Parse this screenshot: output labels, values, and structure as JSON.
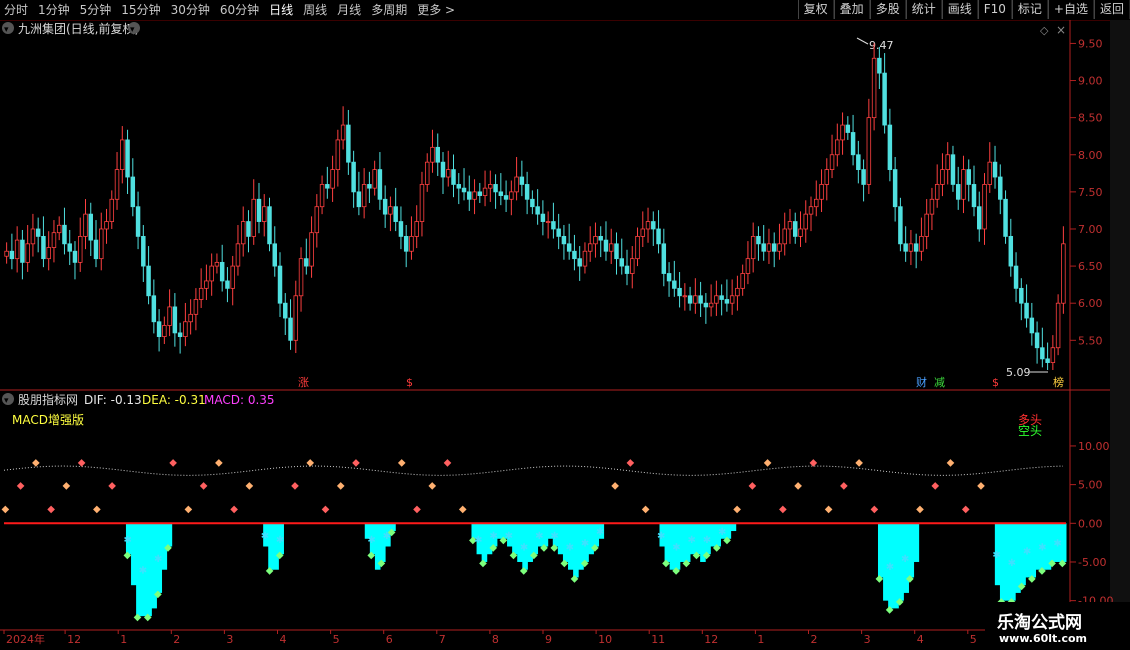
{
  "toolbar": {
    "periods": [
      "分时",
      "1分钟",
      "5分钟",
      "15分钟",
      "30分钟",
      "60分钟",
      "日线",
      "周线",
      "月线",
      "多周期",
      "更多 >"
    ],
    "active_period": "日线",
    "buttons": [
      "复权",
      "叠加",
      "多股",
      "统计",
      "画线",
      "F10",
      "标记",
      "+自选",
      "返回"
    ]
  },
  "stock": {
    "title": "九洲集团(日线,前复权)",
    "high_label": "9.47",
    "low_label": "5.09"
  },
  "indicator": {
    "source": "股朋指标网",
    "dif_text": "DIF: -0.13",
    "dea_text": "DEA: -0.31",
    "macd_text": "MACD: 0.35",
    "name": "MACD增强版",
    "legend_bull": "多头",
    "legend_bear": "空头"
  },
  "markers": [
    {
      "text": "涨",
      "color": "#ff3b3b"
    },
    {
      "text": "$",
      "color": "#ff3b3b"
    },
    {
      "text": "财",
      "color": "#4aa0ff"
    },
    {
      "text": "减",
      "color": "#3cdc3c"
    },
    {
      "text": "$",
      "color": "#ff3b3b"
    },
    {
      "text": "榜",
      "color": "#ffd040"
    }
  ],
  "watermark": {
    "line1": "乐淘公式网",
    "line2": "www.60lt.com"
  },
  "colors": {
    "up": "#ff4040",
    "down": "#50e0e0",
    "axis": "#b02020",
    "cyan_bar": "#00ffff",
    "red_line": "#ff1a1a"
  },
  "chart_data": [
    {
      "type": "candlestick",
      "title": "九洲集团(日线,前复权)",
      "ylim": [
        5.1,
        9.6
      ],
      "yticks": [
        5.5,
        6.0,
        6.5,
        7.0,
        7.5,
        8.0,
        8.5,
        9.0,
        9.5
      ],
      "x_tick_labels": [
        "2024年",
        "12",
        "1",
        "2",
        "3",
        "4",
        "5",
        "6",
        "7",
        "8",
        "9",
        "10",
        "11",
        "12",
        "1",
        "2",
        "3",
        "4",
        "5",
        "6"
      ],
      "close": [
        6.7,
        6.6,
        6.85,
        6.55,
        6.8,
        7.0,
        6.9,
        6.6,
        6.75,
        6.95,
        7.05,
        6.8,
        6.7,
        6.55,
        6.9,
        7.2,
        6.85,
        6.6,
        7.0,
        7.1,
        7.4,
        7.8,
        8.2,
        7.7,
        7.3,
        6.9,
        6.5,
        6.1,
        5.75,
        5.55,
        5.7,
        5.95,
        5.6,
        5.55,
        5.75,
        5.85,
        6.05,
        6.2,
        6.3,
        6.5,
        6.55,
        6.3,
        6.2,
        6.5,
        6.8,
        7.1,
        6.9,
        7.4,
        7.1,
        7.3,
        6.8,
        6.5,
        6.0,
        5.8,
        5.5,
        6.1,
        6.6,
        6.5,
        6.95,
        7.3,
        7.6,
        7.55,
        7.8,
        8.2,
        8.4,
        7.9,
        7.5,
        7.3,
        7.6,
        7.55,
        7.8,
        7.4,
        7.2,
        7.3,
        7.1,
        6.9,
        6.7,
        6.9,
        7.1,
        7.6,
        7.9,
        8.1,
        7.9,
        7.7,
        7.8,
        7.6,
        7.55,
        7.5,
        7.4,
        7.5,
        7.45,
        7.55,
        7.6,
        7.5,
        7.45,
        7.4,
        7.5,
        7.7,
        7.6,
        7.4,
        7.3,
        7.2,
        7.1,
        7.1,
        7.0,
        6.9,
        6.8,
        6.7,
        6.6,
        6.5,
        6.7,
        6.8,
        6.9,
        6.85,
        6.7,
        6.8,
        6.6,
        6.5,
        6.4,
        6.6,
        6.9,
        7.0,
        7.1,
        7.0,
        6.8,
        6.4,
        6.3,
        6.2,
        6.1,
        6.1,
        6.0,
        6.1,
        6.0,
        5.95,
        6.0,
        6.1,
        6.05,
        6.0,
        6.1,
        6.2,
        6.4,
        6.6,
        6.9,
        6.8,
        6.7,
        6.8,
        6.7,
        6.8,
        7.0,
        7.1,
        6.9,
        7.0,
        7.2,
        7.3,
        7.4,
        7.6,
        7.8,
        8.0,
        8.2,
        8.4,
        8.3,
        8.0,
        7.8,
        7.6,
        8.5,
        9.3,
        9.1,
        8.4,
        7.8,
        7.3,
        6.8,
        6.7,
        6.8,
        6.7,
        6.9,
        7.2,
        7.4,
        7.6,
        7.8,
        8.0,
        7.6,
        7.4,
        7.8,
        7.6,
        7.3,
        7.0,
        7.6,
        7.9,
        7.7,
        7.4,
        6.9,
        6.5,
        6.2,
        6.0,
        5.8,
        5.6,
        5.4,
        5.25,
        5.2,
        5.4,
        6.0,
        6.8
      ],
      "high_label": "9.47",
      "low_label": "5.09"
    },
    {
      "type": "bar",
      "title": "MACD增强版",
      "ylim": [
        -12.5,
        14
      ],
      "yticks": [
        10.0,
        5.0,
        0.0,
        -5.0,
        -10.0
      ],
      "series": [
        {
          "name": "MACD",
          "values": [
            0,
            0,
            0,
            0,
            0,
            0,
            0,
            0,
            0,
            0,
            0,
            0,
            0,
            0,
            0,
            0,
            0,
            0,
            0,
            0,
            0,
            0,
            0,
            0,
            -4,
            -8,
            -12,
            -12,
            -12,
            -11,
            -9,
            -6,
            -3,
            0,
            0,
            0,
            0,
            0,
            0,
            0,
            0,
            0,
            0,
            0,
            0,
            0,
            0,
            0,
            0,
            0,
            0,
            -3,
            -6,
            -6,
            -4,
            0,
            0,
            0,
            0,
            0,
            0,
            0,
            0,
            0,
            0,
            0,
            0,
            0,
            0,
            0,
            0,
            -2,
            -4,
            -6,
            -5,
            -3,
            -1,
            0,
            0,
            0,
            0,
            0,
            0,
            0,
            0,
            0,
            0,
            0,
            0,
            0,
            0,
            0,
            -2,
            -4,
            -5,
            -4,
            -3,
            -2,
            -2,
            -3,
            -4,
            -5,
            -6,
            -5,
            -4,
            -3,
            -3,
            -2,
            -3,
            -4,
            -5,
            -6,
            -7,
            -6,
            -5,
            -4,
            -3,
            -2,
            0,
            0,
            0,
            0,
            0,
            0,
            0,
            0,
            0,
            0,
            0,
            -3,
            -5,
            -6,
            -6,
            -5,
            -5,
            -4,
            -4,
            -5,
            -4,
            -3,
            -3,
            -2,
            -2,
            -1,
            0,
            0,
            0,
            0,
            0,
            0,
            0,
            0,
            0,
            0,
            0,
            0,
            0,
            0,
            0,
            0,
            0,
            0,
            0,
            0,
            0,
            0,
            0,
            0,
            0,
            0,
            0,
            0,
            -7,
            -10,
            -11,
            -11,
            -10,
            -9,
            -7,
            -5,
            0,
            0,
            0,
            0,
            0,
            0,
            0,
            0,
            0,
            0,
            0,
            0,
            0,
            0,
            0,
            -8,
            -10,
            -10,
            -10,
            -9,
            -8,
            -7,
            -7,
            -6,
            -6,
            -6,
            -5,
            -5,
            -5
          ]
        }
      ]
    }
  ]
}
